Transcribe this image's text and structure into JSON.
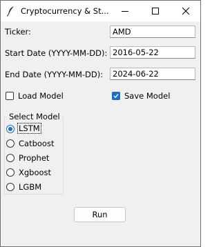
{
  "window": {
    "title": "Cryptocurrency & St...",
    "icons": {
      "app": "feather-icon",
      "minimize": "minimize-icon",
      "maximize": "maximize-icon",
      "close": "close-icon"
    }
  },
  "form": {
    "ticker_label": "Ticker:",
    "ticker_value": "AMD",
    "start_label": "Start Date (YYYY-MM-DD):",
    "start_value": "2016-05-22",
    "end_label": "End Date (YYYY-MM-DD):",
    "end_value": "2024-06-22"
  },
  "options": {
    "load_model": {
      "label": "Load Model",
      "checked": false
    },
    "save_model": {
      "label": "Save Model",
      "checked": true
    }
  },
  "model_group": {
    "title": "Select Model",
    "selected": "LSTM",
    "options": [
      "LSTM",
      "Catboost",
      "Prophet",
      "Xgboost",
      "LGBM"
    ]
  },
  "run_label": "Run",
  "colors": {
    "accent": "#1a6fbf",
    "window_bg": "#f0f0f0"
  }
}
